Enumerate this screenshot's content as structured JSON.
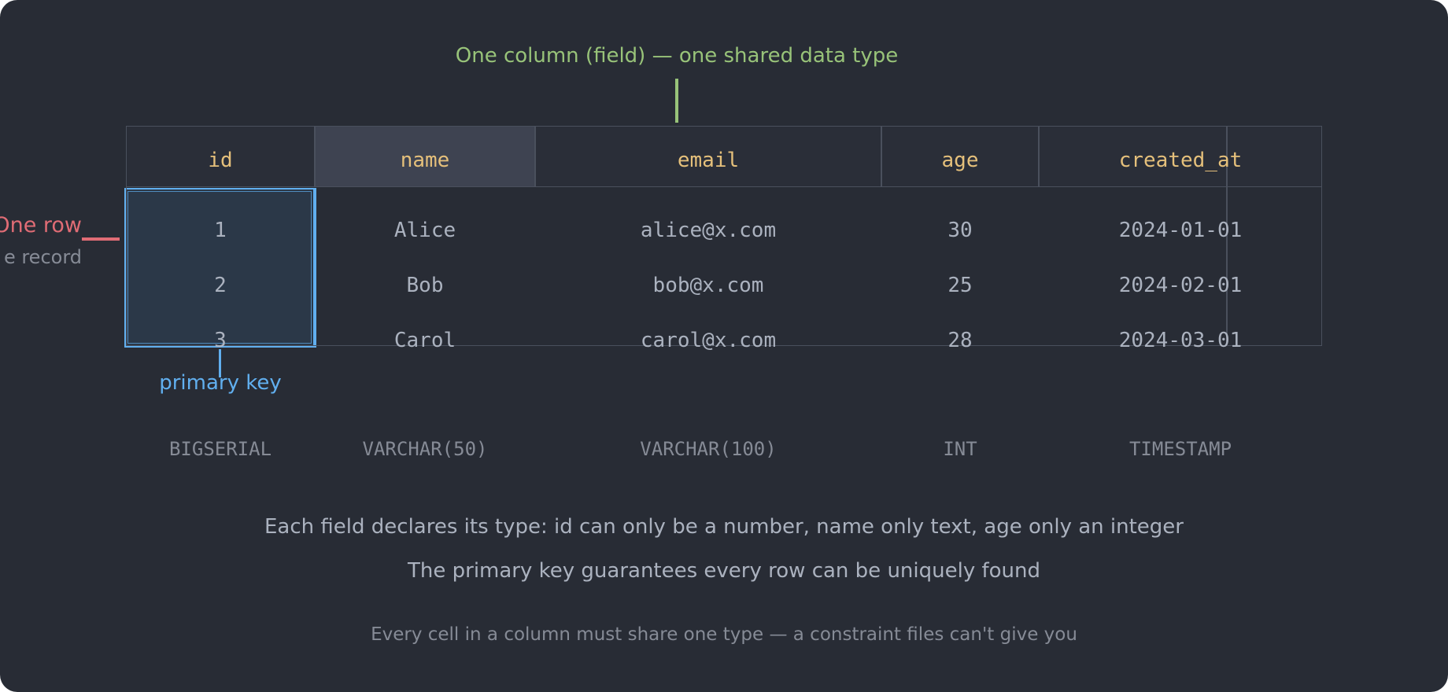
{
  "annotations": {
    "column": "One column (field) — one shared data type",
    "row_label": "One row",
    "row_sub": "e record",
    "primary_key": "primary key"
  },
  "table": {
    "headers": [
      "id",
      "name",
      "email",
      "age",
      "created_at"
    ],
    "highlighted_header": "name",
    "rows": [
      [
        "1",
        "Alice",
        "alice@x.com",
        "30",
        "2024-01-01"
      ],
      [
        "2",
        "Bob",
        "bob@x.com",
        "25",
        "2024-02-01"
      ],
      [
        "3",
        "Carol",
        "carol@x.com",
        "28",
        "2024-03-01"
      ]
    ],
    "types": [
      "BIGSERIAL",
      "VARCHAR(50)",
      "VARCHAR(100)",
      "INT",
      "TIMESTAMP"
    ]
  },
  "notes": [
    "Each field declares its type: id can only be a number, name only text, age only an integer",
    "The primary key guarantees every row can be uniquely found",
    "Every cell in a column must share one type — a constraint files can't give you"
  ],
  "colors": {
    "background": "#282c35",
    "header_text": "#e5c07b",
    "column_accent": "#98c379",
    "row_accent": "#e06c75",
    "primary_key": "#61afef",
    "cell_text": "#abb2bf",
    "muted": "#868b96"
  }
}
